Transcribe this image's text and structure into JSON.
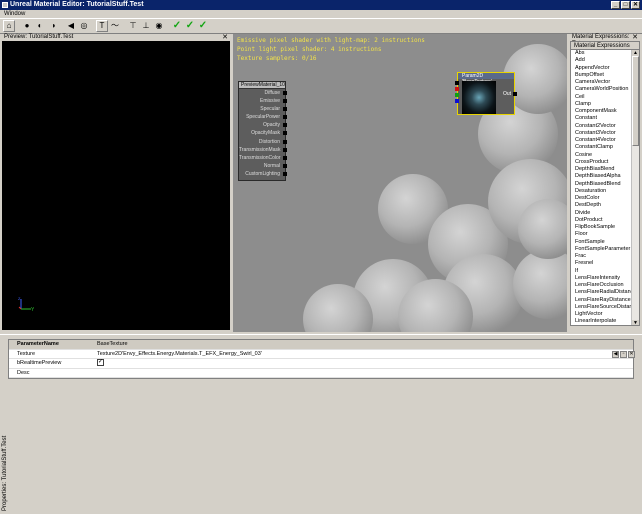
{
  "window": {
    "title": "Unreal Material Editor: TutorialStuff.Test",
    "min": "_",
    "max": "□",
    "close": "✕"
  },
  "menu": {
    "window": "Window"
  },
  "toolbar": {
    "icons": [
      "home-icon",
      "sphere-icon",
      "sphere-alt-icon",
      "sphere-lit-icon",
      "back-icon",
      "globe-icon",
      "text-icon",
      "curve-icon",
      "align-top-icon",
      "align-bottom-icon",
      "eye-icon",
      "apply-check-icon",
      "apply-check-icon",
      "apply-check-icon"
    ]
  },
  "preview": {
    "title": "Preview: TutorialStuff.Test",
    "close": "✕",
    "axis_y": "Y",
    "axis_z": "Z"
  },
  "canvas": {
    "stats": [
      "Emissive pixel shader with light-map: 2 instructions",
      "Point light pixel shader: 4 instructions",
      "Texture samplers: 0/16"
    ],
    "material_node": {
      "title": "PreviewMaterial_10",
      "pins": [
        "Diffuse",
        "Emissive",
        "Specular",
        "SpecularPower",
        "Opacity",
        "OpacityMask",
        "Distortion",
        "TransmissionMask",
        "TransmissionColor",
        "Normal",
        "CustomLighting"
      ]
    },
    "texture_node": {
      "title": "Param2D 'BaseTexture'",
      "output": "Out"
    }
  },
  "expressions": {
    "panel_title": "Material Expressions: Tuto",
    "close": "✕",
    "list_header": "Material Expressions",
    "items": [
      "Abs",
      "Add",
      "AppendVector",
      "BumpOffset",
      "CameraVector",
      "CameraWorldPosition",
      "Ceil",
      "Clamp",
      "ComponentMask",
      "Constant",
      "Constant2Vector",
      "Constant3Vector",
      "Constant4Vector",
      "ConstantClamp",
      "Cosine",
      "CrossProduct",
      "DepthBiasBlend",
      "DepthBiasedAlpha",
      "DepthBiasedBlend",
      "Desaturation",
      "DestColor",
      "DestDepth",
      "Divide",
      "DotProduct",
      "FlipBookSample",
      "Floor",
      "FontSample",
      "FontSampleParameter",
      "Frac",
      "Fresnel",
      "If",
      "LensFlareIntensity",
      "LensFlareOcclusion",
      "LensFlareRadialDistance",
      "LensFlareRayDistance",
      "LensFlareSourceDistance",
      "LightVector",
      "LinearInterpolate"
    ]
  },
  "properties": {
    "tab_label": "Properties: TutorialStuff.Test",
    "rows": [
      {
        "key": "ParameterName",
        "value": "BaseTexture"
      },
      {
        "key": "Texture",
        "value": "Texture2D'Envy_Effects.Energy.Materials.T_EFX_Energy_Swirl_03'"
      },
      {
        "key": "bRealtimePreview",
        "value": "✓"
      },
      {
        "key": "Desc",
        "value": ""
      }
    ]
  },
  "colors": {
    "title_bar": "#0a246a",
    "canvas_bg": "#8d8d8d",
    "stat_text": "#f2e24a",
    "check_green": "#13a513",
    "node_select": "#e8d400"
  }
}
